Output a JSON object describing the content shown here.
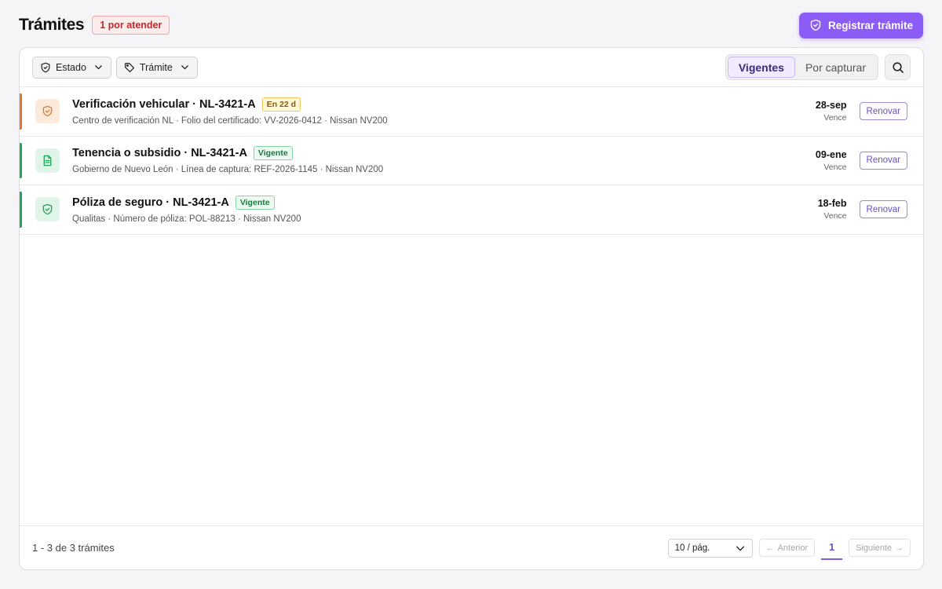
{
  "header": {
    "title": "Trámites",
    "pending_badge": "1 por atender",
    "register_button": "Registrar trámite"
  },
  "toolbar": {
    "filters": [
      {
        "label": "Estado",
        "icon": "shield-icon"
      },
      {
        "label": "Trámite",
        "icon": "tag-icon"
      }
    ],
    "tabs": [
      {
        "label": "Vigentes",
        "active": true
      },
      {
        "label": "Por capturar",
        "active": false
      }
    ]
  },
  "rows": [
    {
      "title": "Verificación vehicular · NL-3421-A",
      "status": "En 22 d",
      "status_kind": "warn",
      "subtitle": "Centro de verificación NL · Folio del certificado: VV-2026-0412 · Nissan NV200",
      "due_date": "28-sep",
      "due_label": "Vence",
      "action": "Renovar",
      "icon": "shield-icon",
      "accent_color": "#e8742a"
    },
    {
      "title": "Tenencia o subsidio · NL-3421-A",
      "status": "Vigente",
      "status_kind": "ok",
      "subtitle": "Gobierno de Nuevo León · Línea de captura: REF-2026-1145 · Nissan NV200",
      "due_date": "09-ene",
      "due_label": "Vence",
      "action": "Renovar",
      "icon": "document-icon",
      "accent_color": "#22a456"
    },
    {
      "title": "Póliza de seguro · NL-3421-A",
      "status": "Vigente",
      "status_kind": "ok",
      "subtitle": "Qualitas · Número de póliza: POL-88213 · Nissan NV200",
      "due_date": "18-feb",
      "due_label": "Vence",
      "action": "Renovar",
      "icon": "shield-icon",
      "accent_color": "#22a456"
    }
  ],
  "footer": {
    "range_text": "1 - 3 de 3 trámites",
    "page_size": "10 / pág.",
    "prev": "Anterior",
    "next": "Siguiente",
    "current_page": "1"
  },
  "colors": {
    "primary": "#8b5cf6",
    "warn": "#e8742a",
    "ok": "#22a456"
  }
}
